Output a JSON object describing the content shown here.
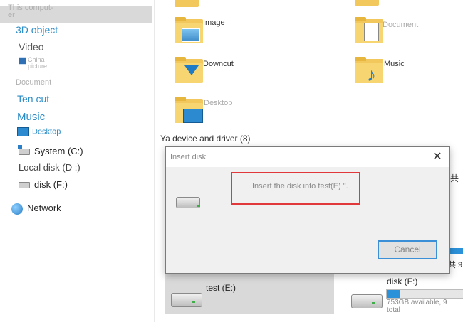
{
  "sidebar": {
    "this_computer": "This comput-\ner",
    "items": {
      "objects3d": "3D object",
      "video": "Video",
      "china_picture": "China\npicture",
      "document": "Document",
      "ten_cut": "Ten cut",
      "music": "Music",
      "desktop": "Desktop",
      "system_c": "System (C:)",
      "local_d": "Local disk (D :)",
      "disk_f": "disk (F:)",
      "network": "Network"
    }
  },
  "content": {
    "folders": {
      "image": "Image",
      "document": "Document",
      "downcut": "Downcut",
      "music": "Music",
      "desktop": "Desktop"
    },
    "devices_title": "Ya device and driver (8)",
    "drives": {
      "test_e": {
        "label": "test (E:)"
      },
      "disk_f": {
        "label": "disk (F:)",
        "free": "753GB available, 9",
        "total": "total",
        "used_fraction": 0.17,
        "total_prefix": "7"
      }
    },
    "peek": {
      "right1": "共",
      "right2": "共 9"
    }
  },
  "dialog": {
    "title": "Insert disk",
    "message": "Insert the disk into test(E) \".",
    "cancel": "Cancel",
    "close_glyph": "✕"
  }
}
